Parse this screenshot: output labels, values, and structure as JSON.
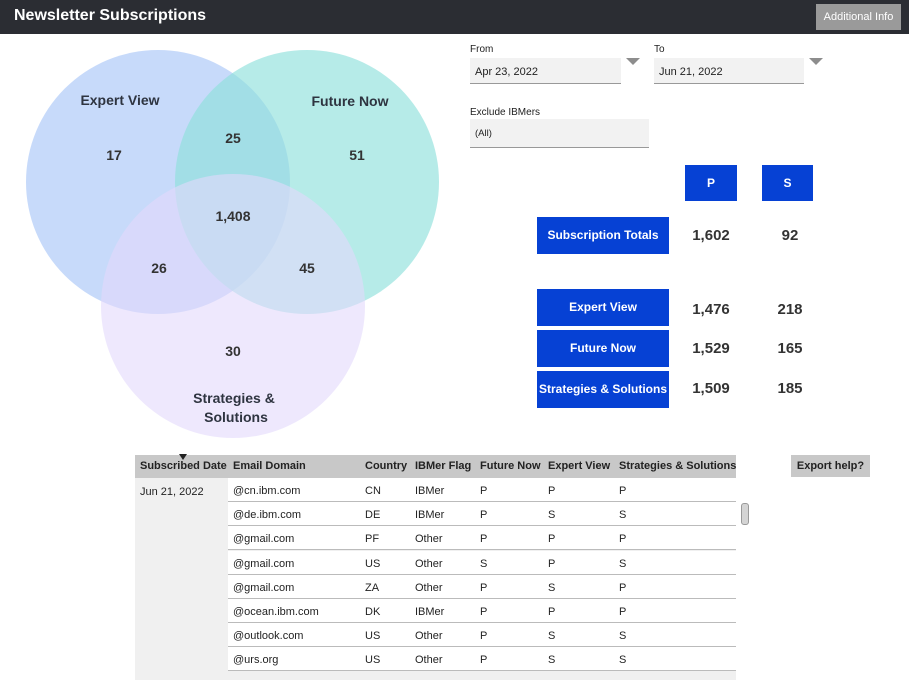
{
  "header": {
    "title": "Newsletter Subscriptions",
    "info_button": "Additional Info"
  },
  "venn": {
    "labels": {
      "expert": "Expert View",
      "future": "Future Now",
      "strategies_line1": "Strategies &",
      "strategies_line2": "Solutions"
    },
    "counts": {
      "expert_only": "17",
      "future_only": "51",
      "strategies_only": "30",
      "expert_future": "25",
      "expert_strategies": "26",
      "future_strategies": "45",
      "all_three": "1,408"
    },
    "colors": {
      "expert": "#a9c6f7",
      "future": "#8fe0dc",
      "strategies": "#e3d8fb"
    }
  },
  "filters": {
    "from_label": "From",
    "from_value": "Apr 23, 2022",
    "to_label": "To",
    "to_value": "Jun 21, 2022",
    "exclude_label": "Exclude IBMers",
    "exclude_value": "(All)"
  },
  "summary": {
    "col_p": "P",
    "col_s": "S",
    "totals": {
      "label": "Subscription Totals",
      "p": "1,602",
      "s": "92"
    },
    "rows": [
      {
        "label": "Expert View",
        "p": "1,476",
        "s": "218"
      },
      {
        "label": "Future Now",
        "p": "1,529",
        "s": "165"
      },
      {
        "label": "Strategies & Solutions",
        "p": "1,509",
        "s": "185"
      }
    ]
  },
  "table": {
    "headers": [
      "Subscribed Date",
      "Email Domain",
      "Country",
      "IBMer Flag",
      "Future Now",
      "Expert View",
      "Strategies & Solutions"
    ],
    "date": "Jun 21, 2022",
    "rows": [
      [
        "@cn.ibm.com",
        "CN",
        "IBMer",
        "P",
        "P",
        "P"
      ],
      [
        "@de.ibm.com",
        "DE",
        "IBMer",
        "P",
        "S",
        "S"
      ],
      [
        "@gmail.com",
        "PF",
        "Other",
        "P",
        "P",
        "P"
      ],
      [
        "@gmail.com",
        "US",
        "Other",
        "S",
        "P",
        "S"
      ],
      [
        "@gmail.com",
        "ZA",
        "Other",
        "P",
        "S",
        "P"
      ],
      [
        "@ocean.ibm.com",
        "DK",
        "IBMer",
        "P",
        "P",
        "P"
      ],
      [
        "@outlook.com",
        "US",
        "Other",
        "P",
        "S",
        "S"
      ],
      [
        "@urs.org",
        "US",
        "Other",
        "P",
        "S",
        "S"
      ]
    ]
  },
  "export_button": "Export help?"
}
